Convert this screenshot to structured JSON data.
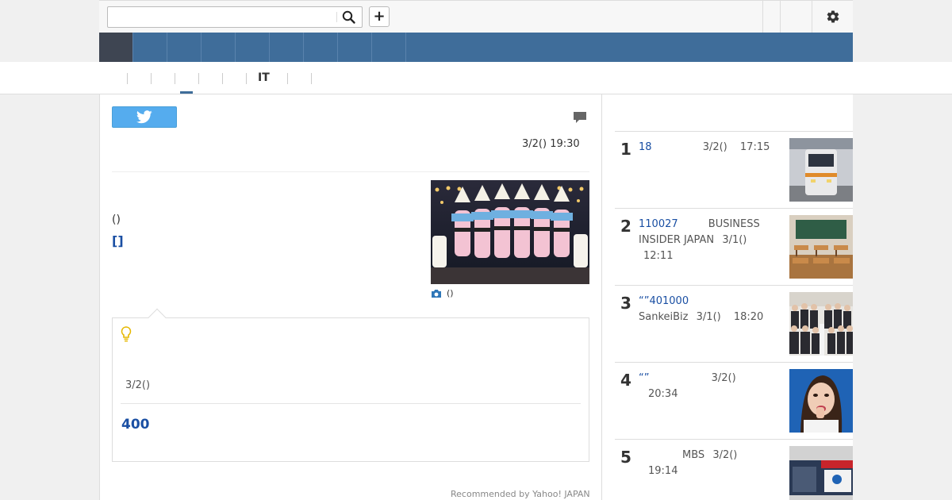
{
  "header": {
    "search_placeholder": "",
    "plus_label": "+"
  },
  "subnav": {
    "it_label": "IT"
  },
  "article": {
    "date": "3/2() 19:30",
    "source_text": "()",
    "link_text": "[]",
    "photo_caption": "()",
    "callout": {
      "date": "3/2()",
      "count": "400"
    },
    "recommended": "Recommended by Yahoo! JAPAN"
  },
  "ranking": [
    {
      "rank": "1",
      "title": "18",
      "source": "",
      "date": "3/2()",
      "time": "17:15"
    },
    {
      "rank": "2",
      "title": "110027",
      "source": "BUSINESS INSIDER JAPAN",
      "date": "3/1()",
      "time": "12:11"
    },
    {
      "rank": "3",
      "title": "“”401000",
      "source": "SankeiBiz",
      "date": "3/1()",
      "time": "18:20"
    },
    {
      "rank": "4",
      "title": "“”",
      "source": "",
      "date": "3/2()",
      "time": "20:34"
    },
    {
      "rank": "5",
      "title": "",
      "source": "MBS",
      "date": "3/2()",
      "time": "19:14"
    }
  ],
  "colors": {
    "nav_blue": "#3f6d9a",
    "nav_active": "#3e4552",
    "link_blue": "#1a4fa3",
    "twitter_blue": "#55acee"
  },
  "icons": [
    "search-icon",
    "plus-icon",
    "gear-icon",
    "twitter-icon",
    "comment-icon",
    "camera-icon",
    "lightbulb-icon"
  ]
}
